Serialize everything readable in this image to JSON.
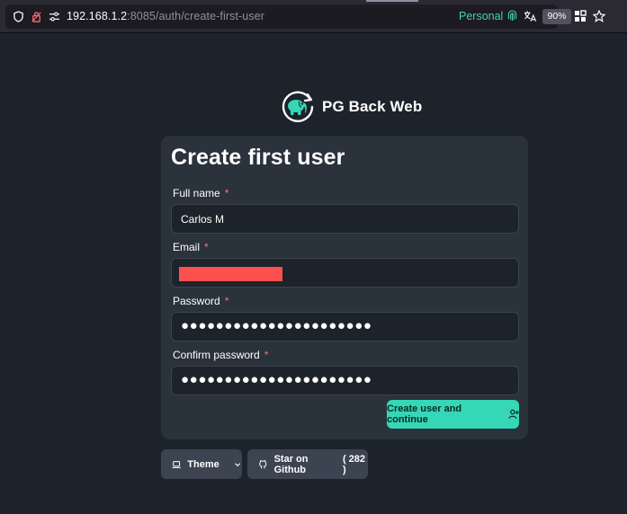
{
  "browser": {
    "url_host": "192.168.1.2",
    "url_rest": ":8085/auth/create-first-user",
    "container_label": "Personal",
    "zoom": "90%"
  },
  "app": {
    "name": "PG Back Web"
  },
  "form": {
    "title": "Create first user",
    "fields": [
      {
        "label": "Full name",
        "required_mark": "*",
        "value": "Carlos M"
      },
      {
        "label": "Email",
        "required_mark": "*",
        "value": ""
      },
      {
        "label": "Password",
        "required_mark": "*",
        "value": "●●●●●●●●●●●●●●●●●●●●●●"
      },
      {
        "label": "Confirm password",
        "required_mark": "*",
        "value": "●●●●●●●●●●●●●●●●●●●●●●"
      }
    ],
    "submit_label": "Create user and continue"
  },
  "footer": {
    "theme_label": "Theme",
    "github_label": "Star on Github",
    "github_count": "( 282 )"
  },
  "colors": {
    "accent": "#36d7b7",
    "background": "#1d232a",
    "card": "#2a323c",
    "required": "#f87272"
  }
}
